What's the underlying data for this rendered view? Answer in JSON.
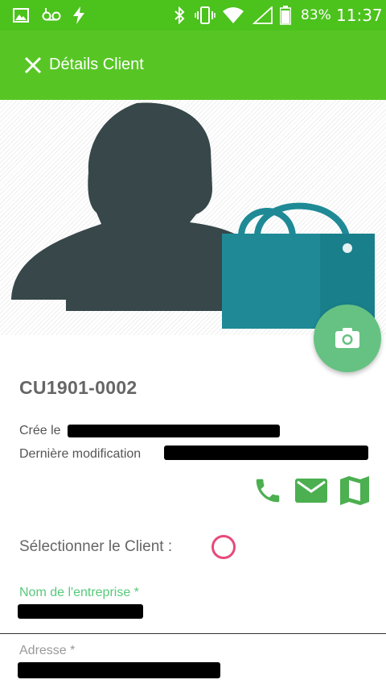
{
  "status_bar": {
    "battery_percent": "83%",
    "time": "11:37",
    "icons": [
      "image-icon",
      "voicemail-icon",
      "flash-icon",
      "bluetooth-icon",
      "vibrate-icon",
      "wifi-icon",
      "signal-icon",
      "battery-icon"
    ]
  },
  "toolbar": {
    "title": "Détails Client",
    "close_icon": "close-icon"
  },
  "colors": {
    "status_bar": "#4cc21d",
    "toolbar": "#57c625",
    "avatar": "#37474a",
    "bag": "#1f8a96",
    "fab": "#66c282",
    "action_green": "#4caf50",
    "radio": "#e8497a",
    "label_active": "#57c97a"
  },
  "client": {
    "code": "CU1901-0002",
    "created_label": "Crée le",
    "modified_label": "Dernière modification"
  },
  "actions": [
    "phone-icon",
    "email-icon",
    "map-icon"
  ],
  "select": {
    "label": "Sélectionner le Client :",
    "checked": false
  },
  "fields": {
    "company_label": "Nom de l'entreprise *",
    "address_label": "Adresse *"
  }
}
